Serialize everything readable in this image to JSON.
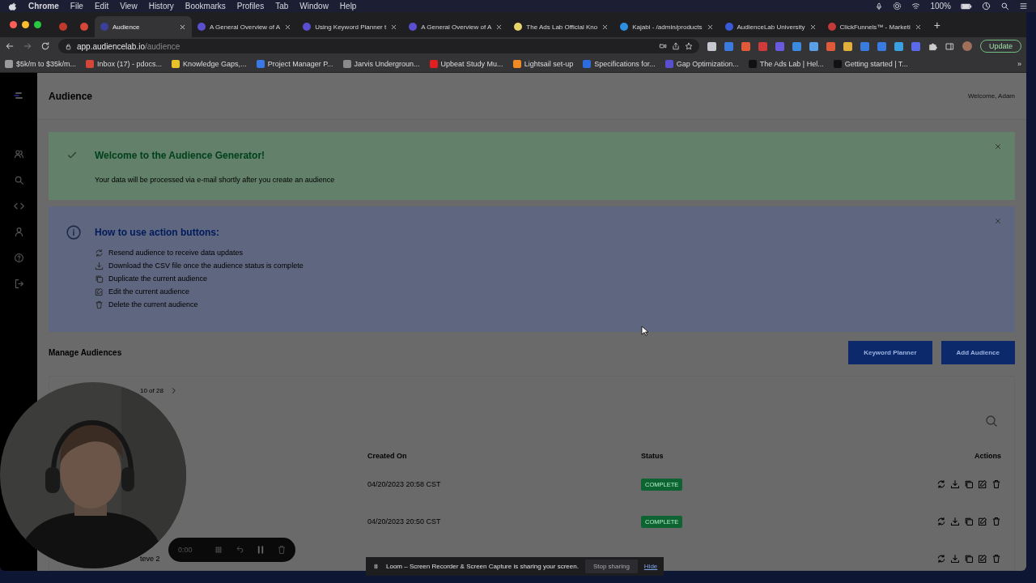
{
  "menubar": {
    "app": "Chrome",
    "menus": [
      "File",
      "Edit",
      "View",
      "History",
      "Bookmarks",
      "Profiles",
      "Tab",
      "Window",
      "Help"
    ],
    "battery": "100%"
  },
  "tabs": [
    {
      "kind": "pinned",
      "selected": false,
      "color": "#c0392b"
    },
    {
      "kind": "pinned",
      "selected": false,
      "color": "#d44638"
    },
    {
      "kind": "page",
      "title": "Audience",
      "selected": true,
      "color": "#3b3f9a"
    },
    {
      "kind": "page",
      "title": "A General Overview of A",
      "selected": false,
      "color": "#5a4fcf"
    },
    {
      "kind": "page",
      "title": "Using Keyword Planner t",
      "selected": false,
      "color": "#5a4fcf"
    },
    {
      "kind": "page",
      "title": "A General Overview of A",
      "selected": false,
      "color": "#5a4fcf"
    },
    {
      "kind": "page",
      "title": "The Ads Lab Official Kno",
      "selected": false,
      "color": "#e8d36a"
    },
    {
      "kind": "page",
      "title": "Kajabi - /admin/products",
      "selected": false,
      "color": "#2d8fe0"
    },
    {
      "kind": "page",
      "title": "AudienceLab University",
      "selected": false,
      "color": "#3a5bd8"
    },
    {
      "kind": "page",
      "title": "ClickFunnels™ - Marketi",
      "selected": false,
      "color": "#c23a3a"
    }
  ],
  "new_tab": "+",
  "address_bar": {
    "host": "app.audiencelab.io",
    "path": "/audience"
  },
  "update_button": "Update",
  "bookmarks": [
    {
      "title": "$5k/m to $35k/m...",
      "color": "#9a9a9a"
    },
    {
      "title": "Inbox (17) - pdocs...",
      "color": "#d44638"
    },
    {
      "title": "Knowledge Gaps,...",
      "color": "#e8c22a"
    },
    {
      "title": "Project Manager P...",
      "color": "#3b78e7"
    },
    {
      "title": "Jarvis Undergroun...",
      "color": "#8a8a8a"
    },
    {
      "title": "Upbeat Study Mu...",
      "color": "#e02020"
    },
    {
      "title": "Lightsail set-up",
      "color": "#f08a24"
    },
    {
      "title": "Specifications for...",
      "color": "#2d6be0"
    },
    {
      "title": "Gap Optimization...",
      "color": "#5a4fcf"
    },
    {
      "title": "The Ads Lab | Hel...",
      "color": "#111111"
    },
    {
      "title": "Getting started | T...",
      "color": "#111111"
    }
  ],
  "bookmarks_more": "»",
  "page": {
    "title": "Audience",
    "welcome": "Welcome, Adam"
  },
  "success_alert": {
    "title": "Welcome to the Audience Generator!",
    "message": "Your data will be processed via e-mail shortly after you create an audience"
  },
  "info_alert": {
    "title": "How to use action buttons:",
    "items": [
      {
        "kind": "resend",
        "text": "Resend audience to receive data updates"
      },
      {
        "kind": "download",
        "text": "Download the CSV file once the audience status is complete"
      },
      {
        "kind": "duplicate",
        "text": "Duplicate the current audience"
      },
      {
        "kind": "edit",
        "text": "Edit the current audience"
      },
      {
        "kind": "delete",
        "text": "Delete the current audience"
      }
    ]
  },
  "manage": {
    "title": "Manage Audiences",
    "buttons": [
      "Keyword Planner",
      "Add Audience"
    ]
  },
  "table": {
    "pagination": "10 of 28",
    "columns": [
      "Created On",
      "Status",
      "Actions"
    ],
    "rows": [
      {
        "created_on": "04/20/2023 20:58 CST",
        "status": "COMPLETE"
      },
      {
        "created_on": "04/20/2023 20:50 CST",
        "status": "COMPLETE"
      },
      {
        "name": "teve 2"
      }
    ]
  },
  "loom": {
    "timer": "0:00",
    "message": "Loom – Screen Recorder & Screen Capture is sharing your screen.",
    "stop": "Stop sharing",
    "hide": "Hide"
  }
}
